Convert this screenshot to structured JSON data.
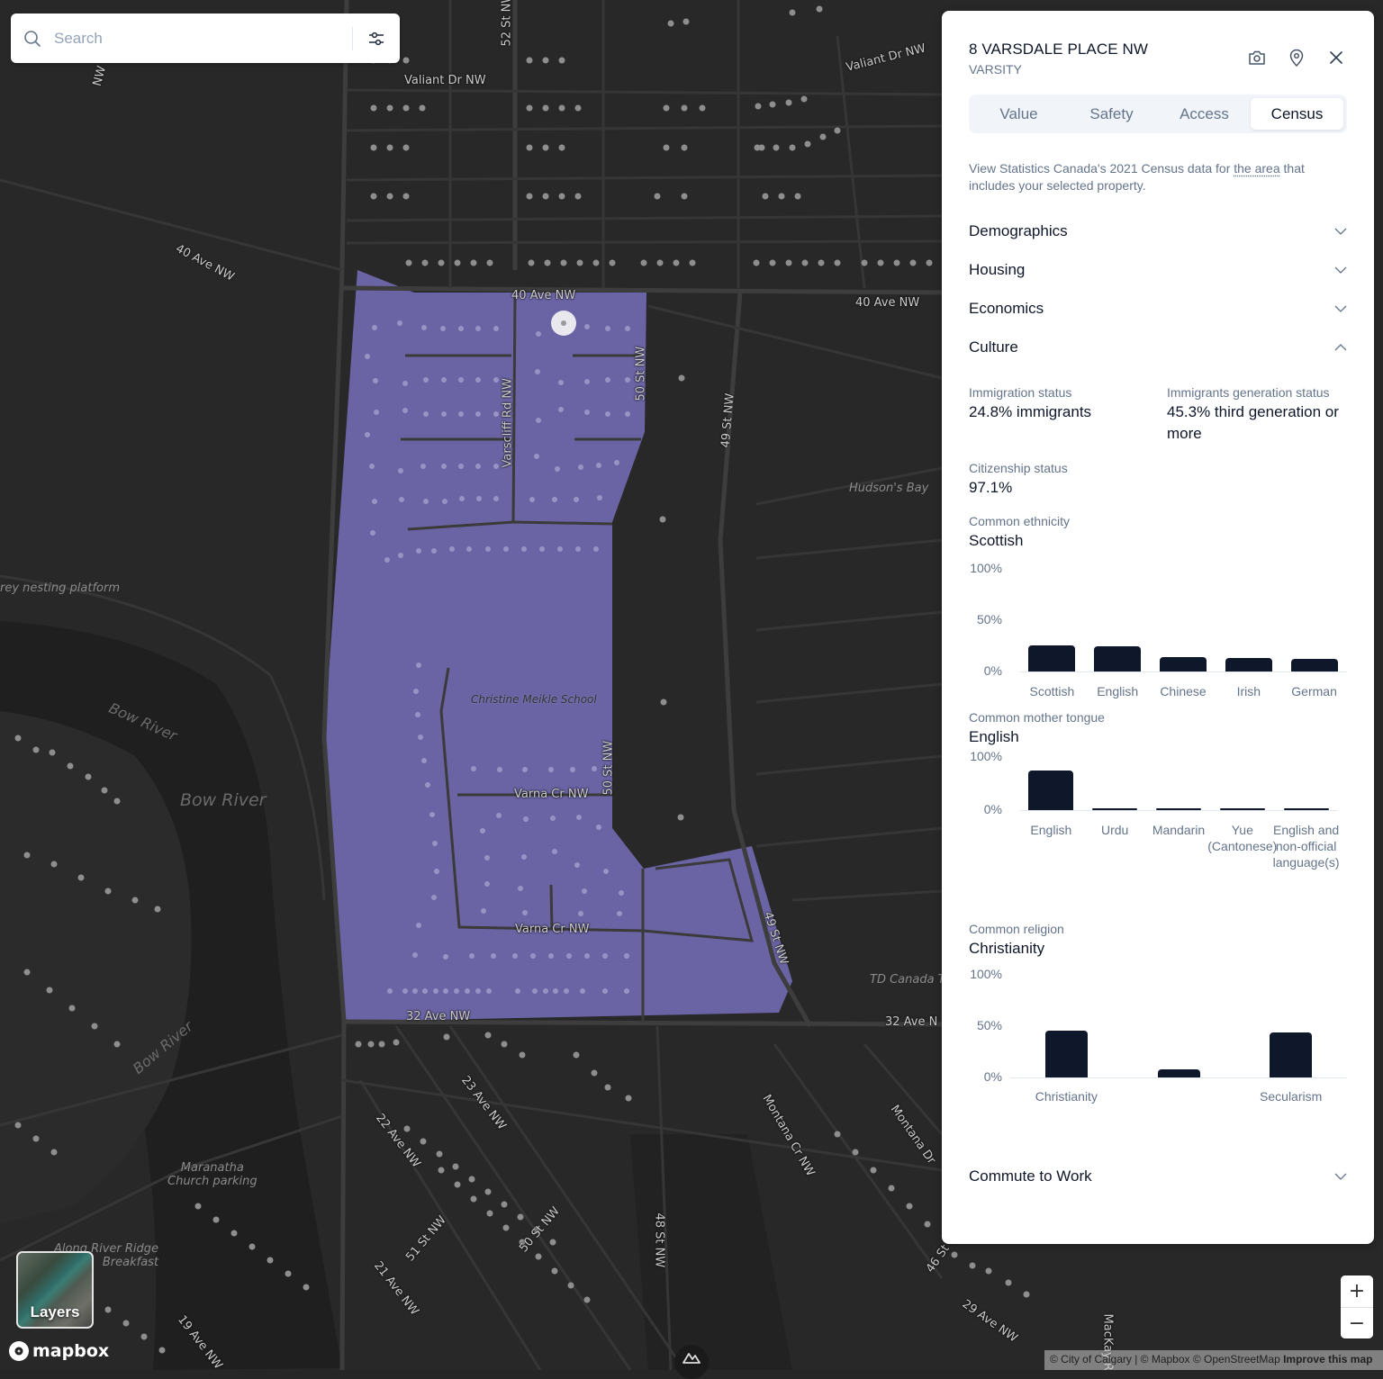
{
  "search": {
    "placeholder": "Search",
    "value": ""
  },
  "layers": {
    "label": "Layers"
  },
  "map": {
    "attribution": "© City of Calgary | © Mapbox © OpenStreetMap",
    "improve_link": "Improve this map",
    "logo": "mapbox",
    "zoom_in": "+",
    "zoom_out": "−",
    "highlight_color": "#6a64a4",
    "labels": {
      "valiant_dr_1": "Valiant Dr NW",
      "valiant_dr_2": "Valiant Dr NW",
      "ave40_left": "40 Ave NW",
      "ave40_mid": "40 Ave NW",
      "ave40_right": "40 Ave NW",
      "st52": "52 St NW",
      "nw_topleft": "NW",
      "varscliff": "Varscliff Rd NW",
      "st50_top": "50 St NW",
      "st49_top": "49 St NW",
      "hudsons_bay": "Hudson's Bay",
      "osprey": "rey nesting platform",
      "bow_river_1": "Bow River",
      "bow_river_2": "Bow River",
      "bow_river_3": "Bow River",
      "school": "Christine Meikle School",
      "st50_mid": "50 St NW",
      "varna_1": "Varna Cr NW",
      "varna_2": "Varna Cr NW",
      "st49_bottom": "49 St NW",
      "td_canada": "TD Canada Tr",
      "ave32_left": "32 Ave NW",
      "ave32_right": "32 Ave N",
      "ave23": "23 Ave NW",
      "ave22": "22 Ave NW",
      "st51": "51 St NW",
      "st50_bottom": "50 St NW",
      "ave21": "21 Ave NW",
      "ave19": "19 Ave NW",
      "st48": "48 St NW",
      "montana_cr": "Montana Cr NW",
      "montana_dr": "Montana Dr",
      "st46": "46 St NW",
      "ave29": "29 Ave NW",
      "mackay": "MacKay R",
      "maranatha": "Maranatha\nChurch parking",
      "river_ridge": "Along River Ridge\nBreakfast"
    }
  },
  "panel": {
    "title": "8 VARSDALE PLACE NW",
    "subtitle": "VARSITY",
    "tabs": [
      {
        "label": "Value",
        "active": false
      },
      {
        "label": "Safety",
        "active": false
      },
      {
        "label": "Access",
        "active": false
      },
      {
        "label": "Census",
        "active": true
      }
    ],
    "intro_before": "View Statistics Canada's 2021 Census data for ",
    "intro_link": "the area",
    "intro_after": " that includes your selected property.",
    "sections": [
      {
        "label": "Demographics",
        "expanded": false
      },
      {
        "label": "Housing",
        "expanded": false
      },
      {
        "label": "Economics",
        "expanded": false
      },
      {
        "label": "Culture",
        "expanded": true
      },
      {
        "label": "Commute to Work",
        "expanded": false
      }
    ],
    "culture": {
      "immigration_label": "Immigration status",
      "immigration_value": "24.8% immigrants",
      "generation_label": "Immigrants generation status",
      "generation_value": "45.3% third generation or more",
      "citizenship_label": "Citizenship status",
      "citizenship_value": "97.1%",
      "ethnicity_label": "Common ethnicity",
      "ethnicity_value": "Scottish",
      "mother_tongue_label": "Common mother tongue",
      "mother_tongue_value": "English",
      "religion_label": "Common religion",
      "religion_value": "Christianity"
    }
  },
  "chart_data": [
    {
      "id": "ethnicity",
      "type": "bar",
      "title": "Common ethnicity",
      "categories": [
        "Scottish",
        "English",
        "Chinese",
        "Irish",
        "German"
      ],
      "values": [
        25.5,
        24.5,
        14,
        13,
        12
      ],
      "yticks": [
        "100%",
        "50%",
        "0%"
      ],
      "ylim": [
        0,
        100
      ],
      "xlabel": "",
      "ylabel": "",
      "grid": false
    },
    {
      "id": "mother_tongue",
      "type": "bar",
      "title": "Common mother tongue",
      "categories": [
        "English",
        "Urdu",
        "Mandarin",
        "Yue (Cantonese)",
        "English and non-official language(s)"
      ],
      "values": [
        75,
        1.5,
        1.5,
        1.5,
        1.5
      ],
      "yticks": [
        "100%",
        "0%"
      ],
      "ylim": [
        0,
        100
      ],
      "xlabel": "",
      "ylabel": "",
      "grid": false
    },
    {
      "id": "religion",
      "type": "bar",
      "title": "Common religion",
      "categories": [
        "Christianity",
        "",
        "Secularism"
      ],
      "values": [
        46,
        8,
        44
      ],
      "yticks": [
        "100%",
        "50%",
        "0%"
      ],
      "ylim": [
        0,
        100
      ],
      "xlabel": "",
      "ylabel": "",
      "grid": false
    }
  ]
}
